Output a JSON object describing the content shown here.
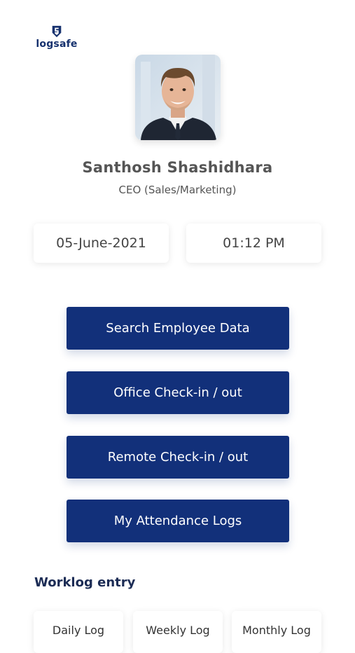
{
  "brand": {
    "name": "logsafe",
    "logo_icon": "shield-icon",
    "color": "#16316e"
  },
  "profile": {
    "avatar_icon": "user-photo",
    "name": "Santhosh Shashidhara",
    "role": "CEO (Sales/Marketing)"
  },
  "info": {
    "date": "05-June-2021",
    "time": "01:12 PM"
  },
  "actions": [
    {
      "label": "Search Employee Data"
    },
    {
      "label": "Office Check-in / out"
    },
    {
      "label": "Remote Check-in / out"
    },
    {
      "label": "My Attendance Logs"
    }
  ],
  "worklog": {
    "title": "Worklog entry",
    "tabs": [
      {
        "label": "Daily Log"
      },
      {
        "label": "Weekly Log"
      },
      {
        "label": "Monthly Log"
      }
    ]
  },
  "colors": {
    "primary": "#12307a",
    "text": "#555555"
  }
}
